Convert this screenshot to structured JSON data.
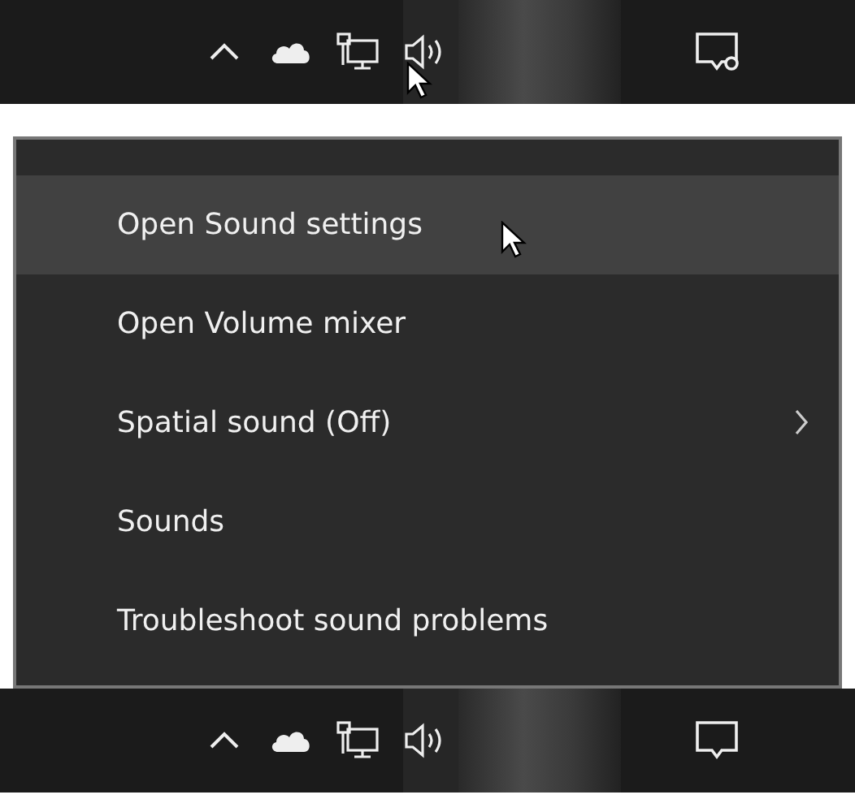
{
  "top_taskbar": {
    "pointer_on_volume": true,
    "notification_badge": true
  },
  "menu": {
    "items": [
      {
        "label": "Open Sound settings",
        "selected": true,
        "submenu": false
      },
      {
        "label": "Open Volume mixer",
        "selected": false,
        "submenu": false
      },
      {
        "label": "Spatial sound (Off)",
        "selected": false,
        "submenu": true
      },
      {
        "label": "Sounds",
        "selected": false,
        "submenu": false
      },
      {
        "label": "Troubleshoot sound problems",
        "selected": false,
        "submenu": false
      }
    ]
  },
  "bottom_taskbar": {
    "pointer_on_volume": false,
    "notification_badge": false
  }
}
